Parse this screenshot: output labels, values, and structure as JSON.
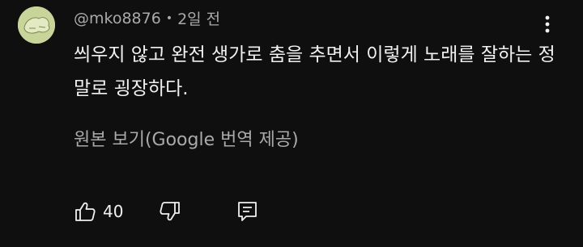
{
  "comment": {
    "author": "@mko8876",
    "separator": "•",
    "time": "2일 전",
    "text": "씌우지 않고 완전 생가로 춤을 추면서 이렇게 노래를 잘하는 정말로 굉장하다.",
    "translate_label": "원본 보기(Google 번역 제공)",
    "like_count": "40"
  },
  "colors": {
    "background": "#0f0f0f",
    "text_primary": "#f1f1f1",
    "text_secondary": "#aaaaaa",
    "avatar_bg": "#c9d49a"
  }
}
